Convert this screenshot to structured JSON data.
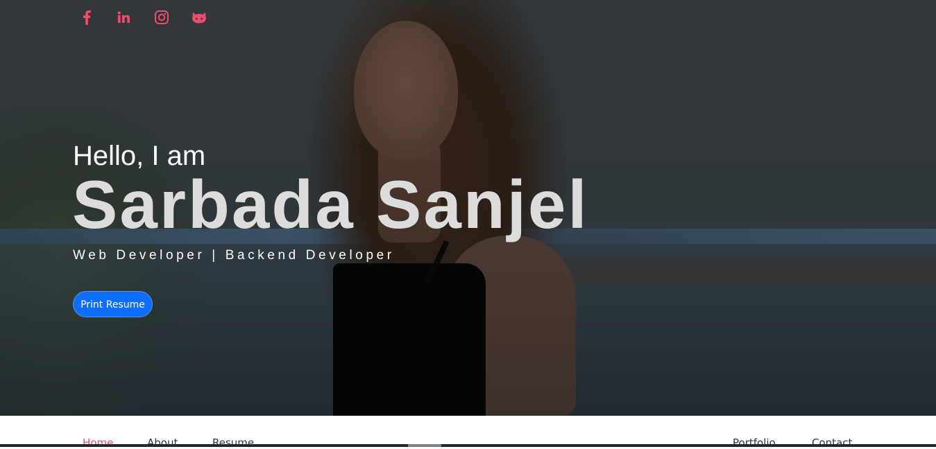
{
  "social": [
    {
      "icon": "facebook-icon",
      "label": "f"
    },
    {
      "icon": "linkedin-icon",
      "label": "in"
    },
    {
      "icon": "instagram-icon"
    },
    {
      "icon": "github-icon"
    }
  ],
  "hero": {
    "greeting": "Hello, I am",
    "name": "Sarbada Sanjel",
    "role": "Web Developer | Backend Developer",
    "button_label": "Print Resume"
  },
  "nav": {
    "items": [
      {
        "label": "Home",
        "active": true
      },
      {
        "label": "About"
      },
      {
        "label": "Resume"
      },
      {
        "label": "Portfolio"
      },
      {
        "label": "Contact"
      }
    ]
  },
  "colors": {
    "accent": "#ef4b6a",
    "button": "#0d6efd",
    "name_text": "#dcdcdc"
  }
}
